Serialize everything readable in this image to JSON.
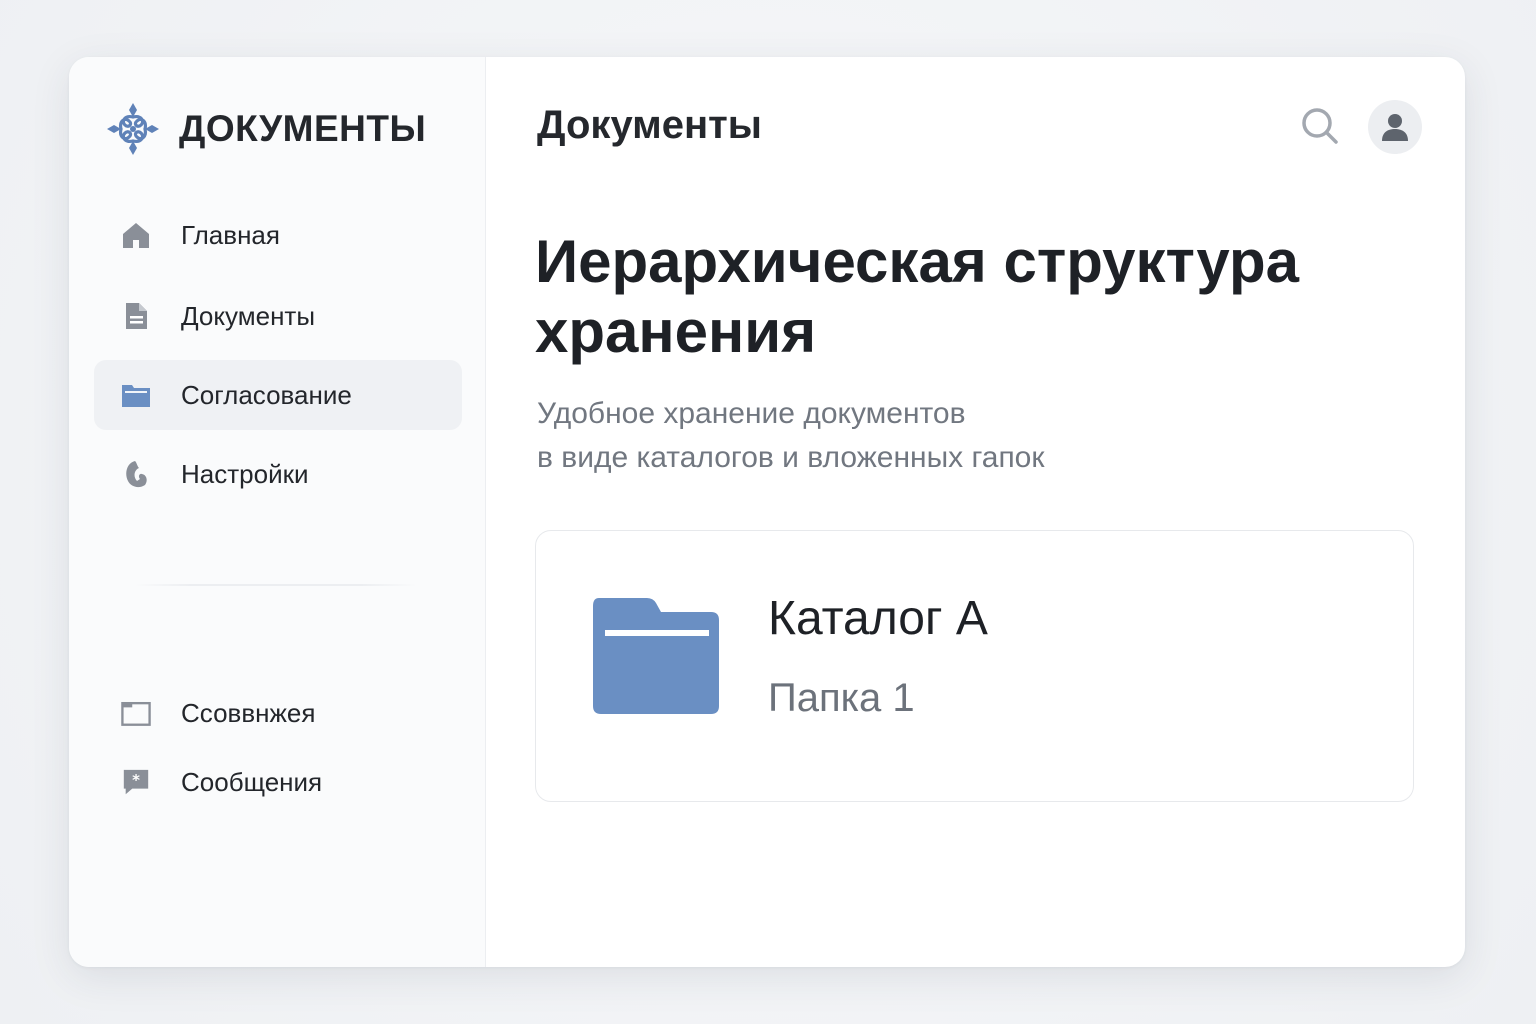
{
  "sidebar": {
    "brand_title": "ДОКУМЕНТЫ",
    "nav": [
      {
        "label": "Главная",
        "icon": "home-icon"
      },
      {
        "label": "Документы",
        "icon": "document-icon"
      },
      {
        "label": "Согласование",
        "icon": "folder-icon",
        "active": true
      },
      {
        "label": "Настройки",
        "icon": "settings-icon"
      }
    ],
    "bottom_nav": [
      {
        "label": "Ссоввнжея",
        "icon": "window-icon"
      },
      {
        "label": "Сообщения",
        "icon": "message-icon"
      }
    ]
  },
  "header": {
    "title": "Документы",
    "search_icon": "search-icon",
    "avatar_icon": "user-icon"
  },
  "main": {
    "headline": "Иерархическая структура хранения",
    "subtitle_line1": "Удобное хранение документов",
    "subtitle_line2": "в виде каталогов и вложенных гапок",
    "card": {
      "title": "Каталог А",
      "subtitle": "Папка 1",
      "icon": "folder-icon"
    }
  },
  "colors": {
    "accent": "#6a8fc3",
    "icon_gray": "#8a8f98",
    "active_bg": "#eff1f4"
  }
}
